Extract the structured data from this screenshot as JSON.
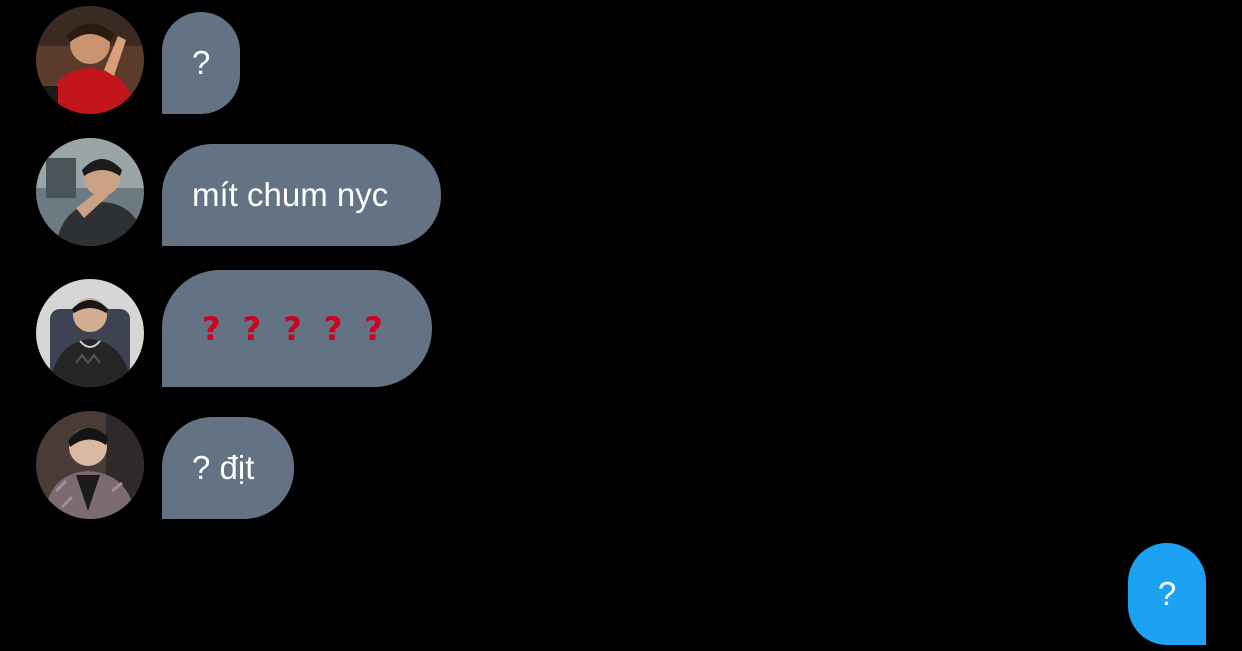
{
  "messages": [
    {
      "sender": "avatar-1",
      "text": "?"
    },
    {
      "sender": "avatar-2",
      "text": "mít chum nyc"
    },
    {
      "sender": "avatar-3",
      "marks": [
        "?",
        "?",
        "?",
        "?",
        "?"
      ],
      "mark_color": "#d0021b"
    },
    {
      "sender": "avatar-4",
      "text": "? địt"
    }
  ],
  "my_message": {
    "text": "?"
  },
  "colors": {
    "background": "#000000",
    "incoming_bubble": "#637384",
    "outgoing_bubble": "#1da1f2",
    "text": "#ffffff"
  }
}
